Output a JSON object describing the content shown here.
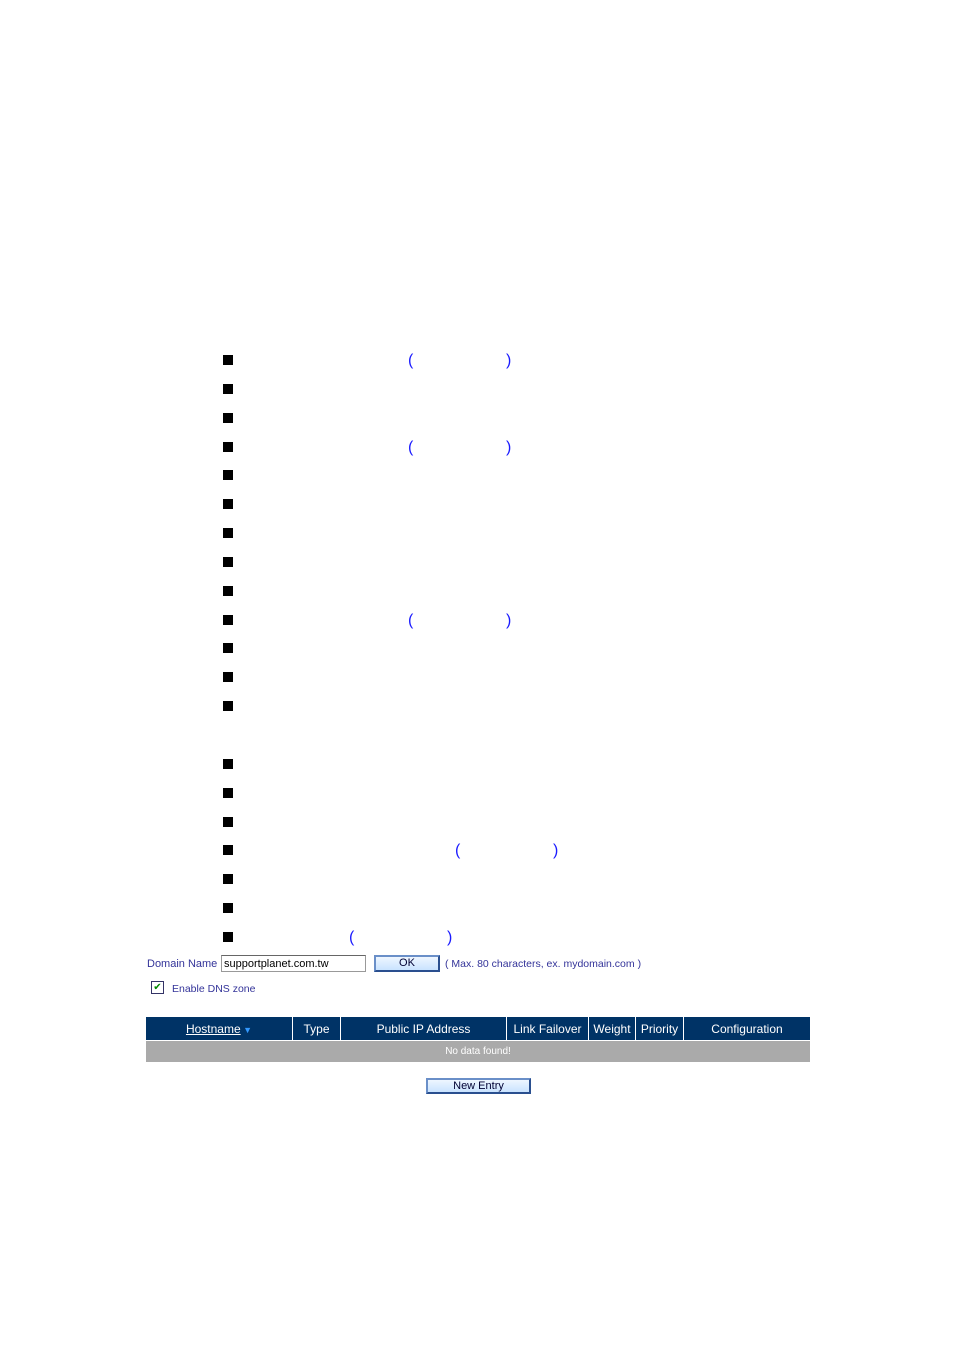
{
  "bullets": {
    "open_paren": "(",
    "close_paren": ")"
  },
  "form": {
    "domain_label": "Domain Name :",
    "domain_value": "supportplanet.com.tw",
    "ok_label": "OK",
    "hint": "( Max. 80 characters, ex.  mydomain.com )",
    "enable_dns_label": "Enable DNS zone",
    "enable_dns_checked": true
  },
  "table": {
    "columns": [
      "Hostname",
      "Type",
      "Public IP Address",
      "Link Failover",
      "Weight",
      "Priority",
      "Configuration"
    ],
    "sort_icon": "triangle-down",
    "empty_message": "No data found!"
  },
  "new_entry_label": "New Entry",
  "colors": {
    "header_bg": "#003366",
    "empty_row_bg": "#aaaaaa",
    "label": "#333399"
  }
}
